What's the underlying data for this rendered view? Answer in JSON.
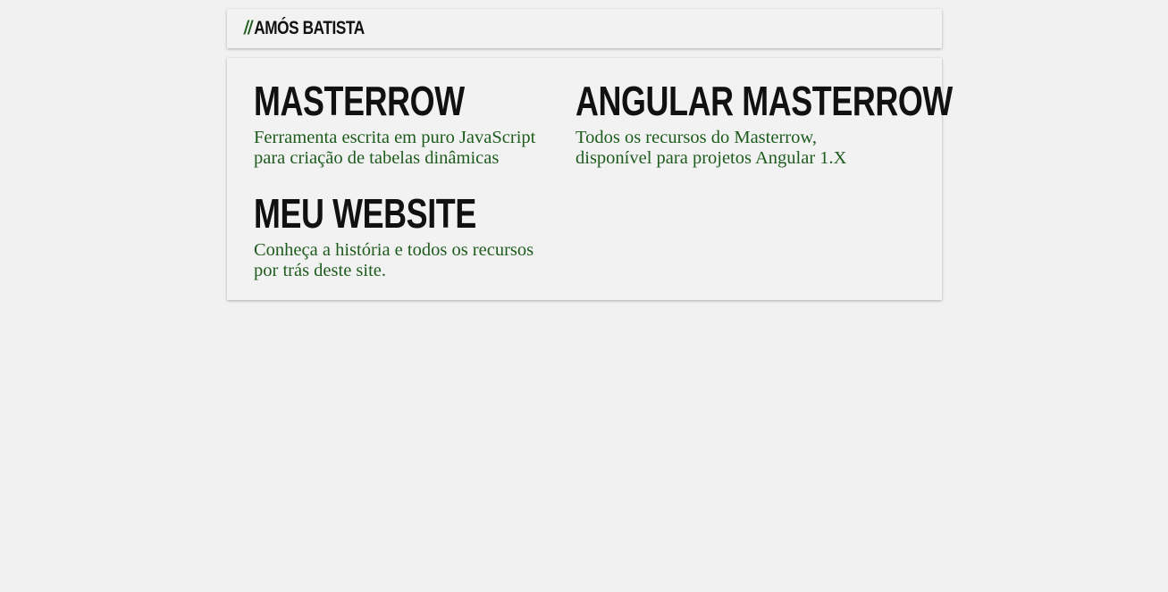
{
  "header": {
    "slashes": "//",
    "brand": "AMÓS BATISTA"
  },
  "projects": [
    {
      "title": "MASTERROW",
      "description": "Ferramenta escrita em puro JavaScript para criação de tabelas dinâmicas"
    },
    {
      "title": "ANGULAR MASTERROW",
      "description": "Todos os recursos do Masterrow, disponível para projetos Angular 1.X"
    },
    {
      "title": "MEU WEBSITE",
      "description": "Conheça a história e todos os recursos por trás deste site."
    }
  ],
  "colors": {
    "background": "#f1f1f1",
    "card": "#f2f2f2",
    "title": "#111111",
    "accent_green": "#1e5c1e"
  }
}
